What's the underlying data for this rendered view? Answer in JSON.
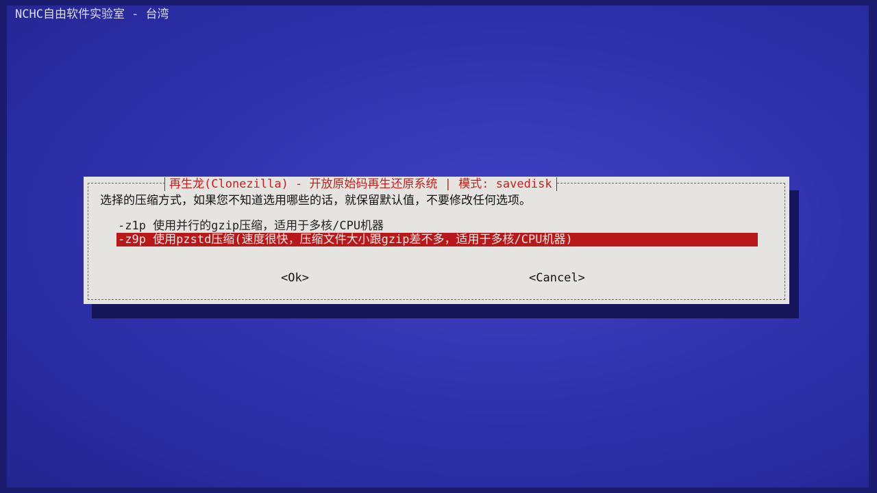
{
  "backtitle": "NCHC自由软件实验室 - 台湾",
  "dialog": {
    "title": "再生龙(Clonezilla) - 开放原始码再生还原系统 | 模式: savedisk",
    "prompt": "选择的压缩方式，如果您不知道选用哪些的话，就保留默认值，不要修改任何选项。",
    "options": [
      {
        "label": "-z1p 使用并行的gzip压缩，适用于多核/CPU机器",
        "selected": false
      },
      {
        "label": "-z9p 使用pzstd压缩(速度很快，压缩文件大小跟gzip差不多，适用于多核/CPU机器)",
        "selected": true
      }
    ],
    "ok_label": "<Ok>",
    "cancel_label": "<Cancel>"
  },
  "colors": {
    "background": "#3436b3",
    "dialog": "#e6e4e0",
    "title_text": "#c4201c",
    "selection": "#b8181a"
  }
}
